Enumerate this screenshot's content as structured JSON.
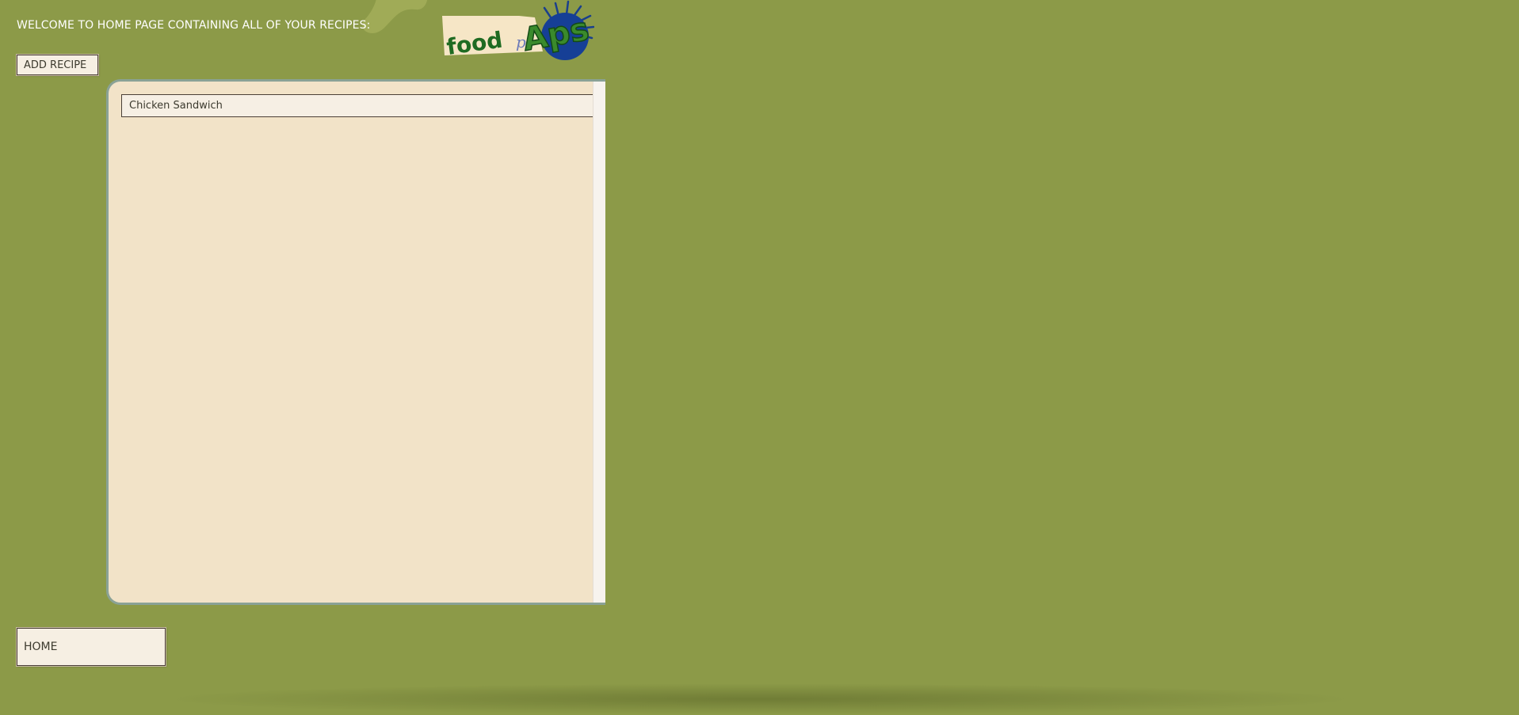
{
  "header": {
    "welcome_text": "WELCOME TO HOME PAGE CONTAINING ALL OF YOUR RECIPES:"
  },
  "logo": {
    "word_food": "food",
    "word_p": "p",
    "word_apps": "Aps",
    "icon": "food-apps-logo-icon"
  },
  "toolbar": {
    "add_recipe_label": "ADD RECIPE"
  },
  "recipes": [
    {
      "name": "Chicken Sandwich"
    }
  ],
  "footer": {
    "home_label": "HOME"
  },
  "colors": {
    "background": "#8c9a48",
    "panel": "#f2e3c8",
    "panel_border": "#8aa296",
    "button_bg": "#f6efe3",
    "logo_green": "#1f6b22",
    "logo_blue": "#1a3f8c"
  }
}
